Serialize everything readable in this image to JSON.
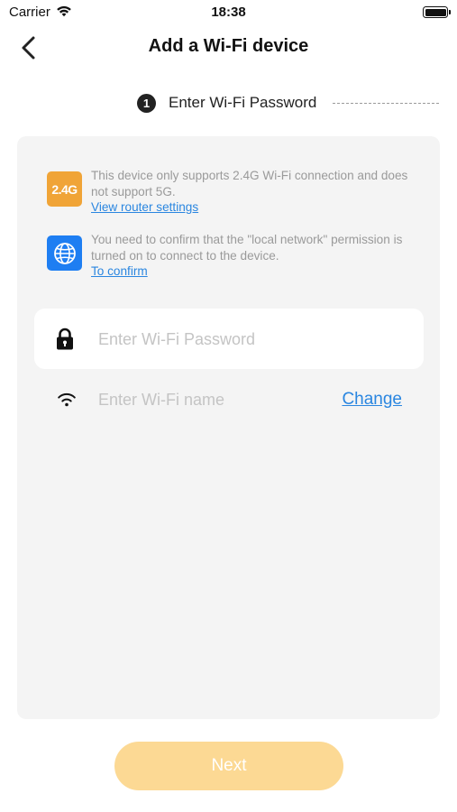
{
  "status_bar": {
    "carrier": "Carrier",
    "time": "18:38",
    "icons": [
      "wifi-icon",
      "battery-icon"
    ]
  },
  "header": {
    "title": "Add a Wi-Fi device",
    "back_icon": "chevron-left-icon"
  },
  "step": {
    "number": "1",
    "label": "Enter Wi-Fi Password"
  },
  "notices": [
    {
      "icon": "2.4G",
      "text": "This device only supports 2.4G Wi-Fi connection and does not support 5G.",
      "link": "View router settings"
    },
    {
      "icon": "globe-icon",
      "text": "You need to confirm that the \"local network\" permission is turned on to connect to the device.",
      "link": "To confirm"
    }
  ],
  "password_field": {
    "icon": "lock-icon",
    "value": "",
    "placeholder": "Enter Wi-Fi Password"
  },
  "wifi_field": {
    "icon": "wifi-icon",
    "value": "",
    "placeholder": "Enter Wi-Fi name",
    "change_label": "Change"
  },
  "next_button": {
    "label": "Next",
    "enabled": false
  },
  "colors": {
    "accent_disabled": "#fcd994",
    "badge_orange": "#f0a437",
    "badge_blue": "#1e7ef2",
    "link": "#2a86e0",
    "card_bg": "#f4f4f4"
  }
}
